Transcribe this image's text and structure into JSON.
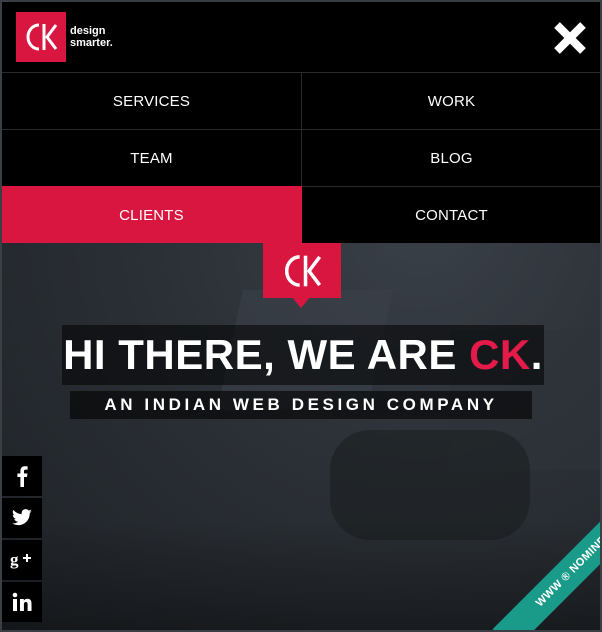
{
  "brand": {
    "logo_line1": "design",
    "logo_line2": "smarter.",
    "logo_mark": "CK",
    "accent_color": "#d8163f"
  },
  "nav": {
    "close_icon": "close-icon",
    "items": [
      {
        "label": "SERVICES",
        "active": false
      },
      {
        "label": "WORK",
        "active": false
      },
      {
        "label": "TEAM",
        "active": false
      },
      {
        "label": "BLOG",
        "active": false
      },
      {
        "label": "CLIENTS",
        "active": true
      },
      {
        "label": "CONTACT",
        "active": false
      }
    ]
  },
  "hero": {
    "headline_prefix": "HI THERE, WE ARE ",
    "headline_accent": "CK",
    "headline_suffix": ".",
    "subline": "AN INDIAN WEB DESIGN COMPANY"
  },
  "social": [
    {
      "name": "facebook",
      "glyph": "f"
    },
    {
      "name": "twitter",
      "glyph": "twitter"
    },
    {
      "name": "google-plus",
      "glyph": "g+"
    },
    {
      "name": "linkedin",
      "glyph": "in"
    }
  ],
  "ribbon": {
    "label": "WWW ® NOMINEE",
    "color": "#1a9a89"
  }
}
